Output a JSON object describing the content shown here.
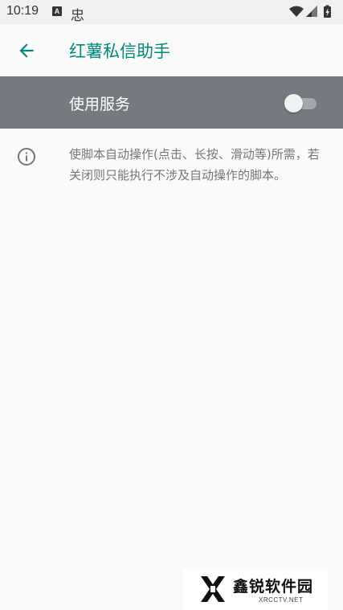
{
  "status_bar": {
    "time": "10:19",
    "notification_icon_letter": "A",
    "app_icon_glyph": "忠",
    "icons": [
      "a-notification-icon",
      "app-notification-icon",
      "wifi-icon",
      "signal-icon",
      "battery-icon"
    ]
  },
  "app_bar": {
    "back_icon": "arrow-left-icon",
    "title": "红薯私信助手"
  },
  "service_switch": {
    "label": "使用服务",
    "enabled": false
  },
  "info": {
    "icon": "info-icon",
    "text": "使脚本自动操作(点击、长按、滑动等)所需，若关闭则只能执行不涉及自动操作的脚本。"
  },
  "watermark": {
    "title": "鑫锐软件园",
    "subtitle": "XRCCTV.NET"
  },
  "colors": {
    "accent": "#00897b",
    "switch_bar_bg": "#757a80",
    "page_bg": "#fafafa",
    "status_bar_bg": "#f0f0f0"
  }
}
